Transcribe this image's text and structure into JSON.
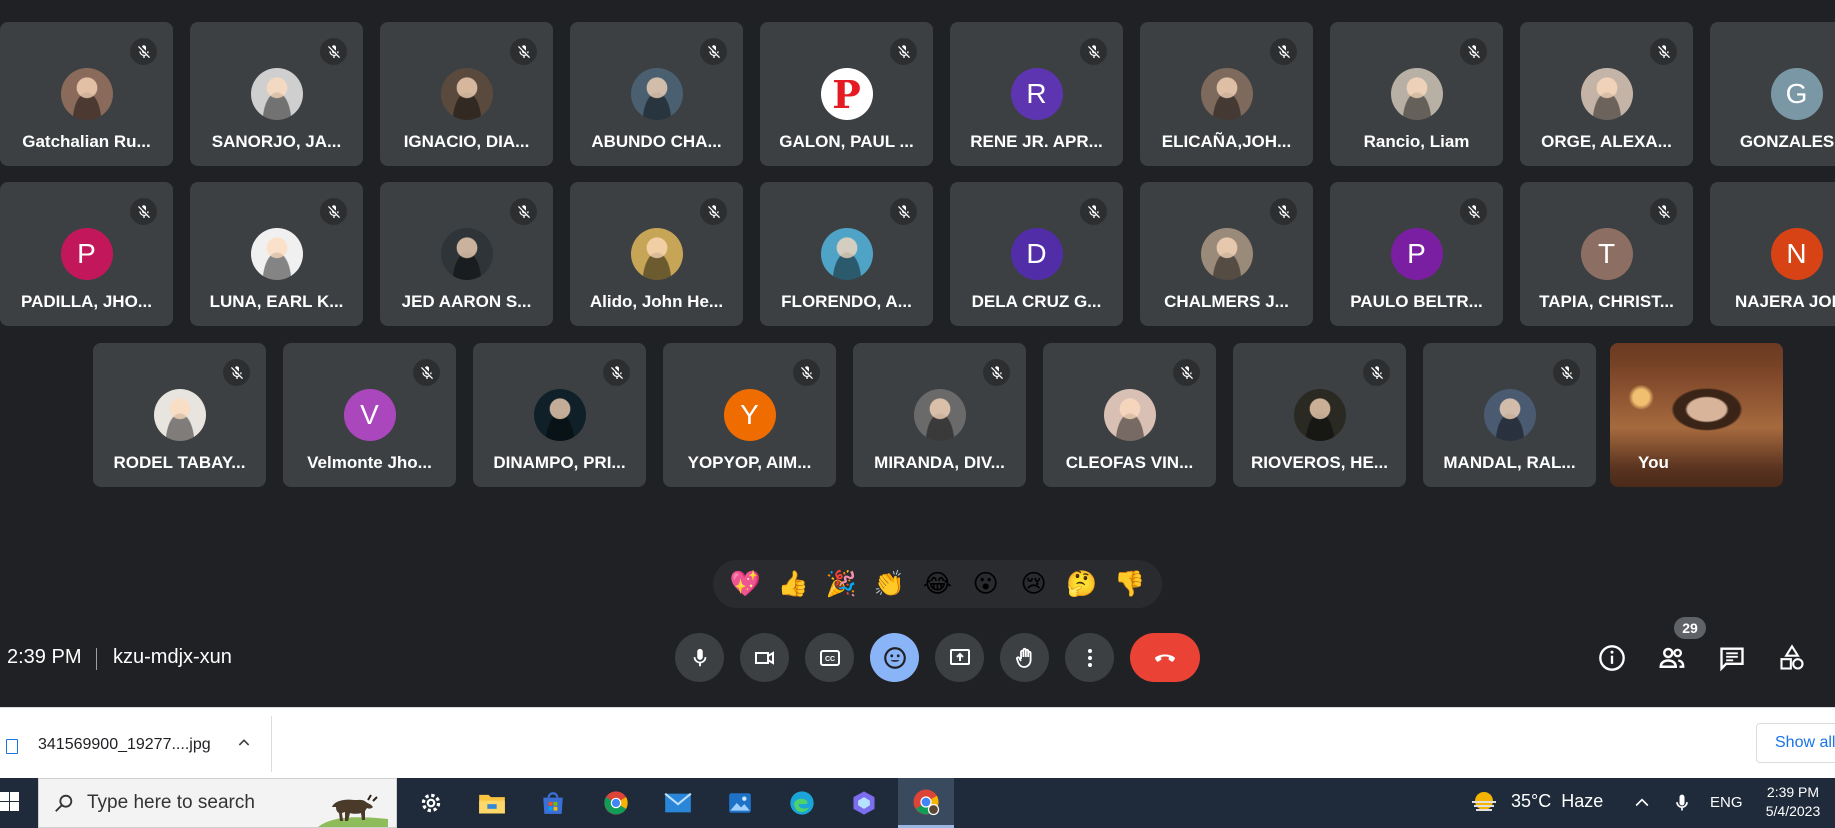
{
  "participants_row1": [
    {
      "name": "Gatchalian Ru...",
      "avatar_type": "photo",
      "avatar_color": "#8a6a5a"
    },
    {
      "name": "SANORJO, JA...",
      "avatar_type": "photo",
      "avatar_color": "#cfcfcf"
    },
    {
      "name": "IGNACIO, DIA...",
      "avatar_type": "photo",
      "avatar_color": "#5a4a3e"
    },
    {
      "name": "ABUNDO CHA...",
      "avatar_type": "photo",
      "avatar_color": "#4a6070"
    },
    {
      "name": "GALON, PAUL ...",
      "avatar_type": "logo",
      "avatar_letter": "P",
      "avatar_color": "#e51b23"
    },
    {
      "name": "RENE JR. APR...",
      "avatar_type": "letter",
      "avatar_letter": "R",
      "avatar_color": "#5e35b1"
    },
    {
      "name": "ELICAÑA,JOH...",
      "avatar_type": "photo",
      "avatar_color": "#7d6a5c"
    },
    {
      "name": "Rancio, Liam",
      "avatar_type": "photo",
      "avatar_color": "#b8b0a4"
    },
    {
      "name": "ORGE, ALEXA...",
      "avatar_type": "photo",
      "avatar_color": "#c4b4a8"
    },
    {
      "name": "GONZALES, J",
      "avatar_type": "letter",
      "avatar_letter": "G",
      "avatar_color": "#7a97a5"
    }
  ],
  "participants_row2": [
    {
      "name": "PADILLA, JHO...",
      "avatar_type": "letter",
      "avatar_letter": "P",
      "avatar_color": "#c2185b"
    },
    {
      "name": "LUNA, EARL K...",
      "avatar_type": "photo",
      "avatar_color": "#f0f0f0"
    },
    {
      "name": "JED AARON S...",
      "avatar_type": "photo",
      "avatar_color": "#2e3438"
    },
    {
      "name": "Alido, John He...",
      "avatar_type": "photo",
      "avatar_color": "#c7a557"
    },
    {
      "name": "FLORENDO, A...",
      "avatar_type": "photo",
      "avatar_color": "#4fa3c6"
    },
    {
      "name": "DELA CRUZ G...",
      "avatar_type": "letter",
      "avatar_letter": "D",
      "avatar_color": "#512da8"
    },
    {
      "name": "CHALMERS J...",
      "avatar_type": "photo",
      "avatar_color": "#9a8a7a"
    },
    {
      "name": "PAULO BELTR...",
      "avatar_type": "letter",
      "avatar_letter": "P",
      "avatar_color": "#7b1fa2"
    },
    {
      "name": "TAPIA, CHRIST...",
      "avatar_type": "letter",
      "avatar_letter": "T",
      "avatar_color": "#8d6e63"
    },
    {
      "name": "NAJERA JOH...",
      "avatar_type": "letter",
      "avatar_letter": "N",
      "avatar_color": "#d84315"
    }
  ],
  "participants_row3": [
    {
      "name": "RODEL TABAY...",
      "avatar_type": "photo",
      "avatar_color": "#e8e4e0"
    },
    {
      "name": "Velmonte Jho...",
      "avatar_type": "letter",
      "avatar_letter": "V",
      "avatar_color": "#ab47bc"
    },
    {
      "name": "DINAMPO, PRI...",
      "avatar_type": "photo",
      "avatar_color": "#102028"
    },
    {
      "name": "YOPYOP, AIM...",
      "avatar_type": "letter",
      "avatar_letter": "Y",
      "avatar_color": "#ef6c00"
    },
    {
      "name": "MIRANDA, DIV...",
      "avatar_type": "photo",
      "avatar_color": "#6a6a6a"
    },
    {
      "name": "CLEOFAS VIN...",
      "avatar_type": "photo",
      "avatar_color": "#d8c0b4"
    },
    {
      "name": "RIOVEROS, HE...",
      "avatar_type": "photo",
      "avatar_color": "#2a2a22"
    },
    {
      "name": "MANDAL, RAL...",
      "avatar_type": "photo",
      "avatar_color": "#4a5a70"
    }
  ],
  "self_tile": {
    "name": "You"
  },
  "reactions": [
    "💖",
    "👍",
    "🎉",
    "👏",
    "😂",
    "😮",
    "😢",
    "🤔",
    "👎"
  ],
  "meeting": {
    "time": "2:39 PM",
    "code": "kzu-mdjx-xun"
  },
  "participant_count": "29",
  "colors": {
    "leave_button": "#ea4335",
    "active_button": "#8ab4f8",
    "tile_bg": "#3c4043",
    "background": "#202124"
  },
  "download": {
    "filename": "341569900_19277....jpg",
    "show_all": "Show all"
  },
  "taskbar": {
    "search_placeholder": "Type here to search",
    "weather": "35°C  Haze",
    "language": "ENG",
    "time": "2:39 PM",
    "date": "5/4/2023",
    "apps": [
      "settings-icon",
      "file-explorer-icon",
      "microsoft-store-icon",
      "chrome-icon",
      "mail-icon",
      "photos-icon",
      "edge-icon",
      "copilot-icon",
      "chrome-profile-icon"
    ]
  }
}
